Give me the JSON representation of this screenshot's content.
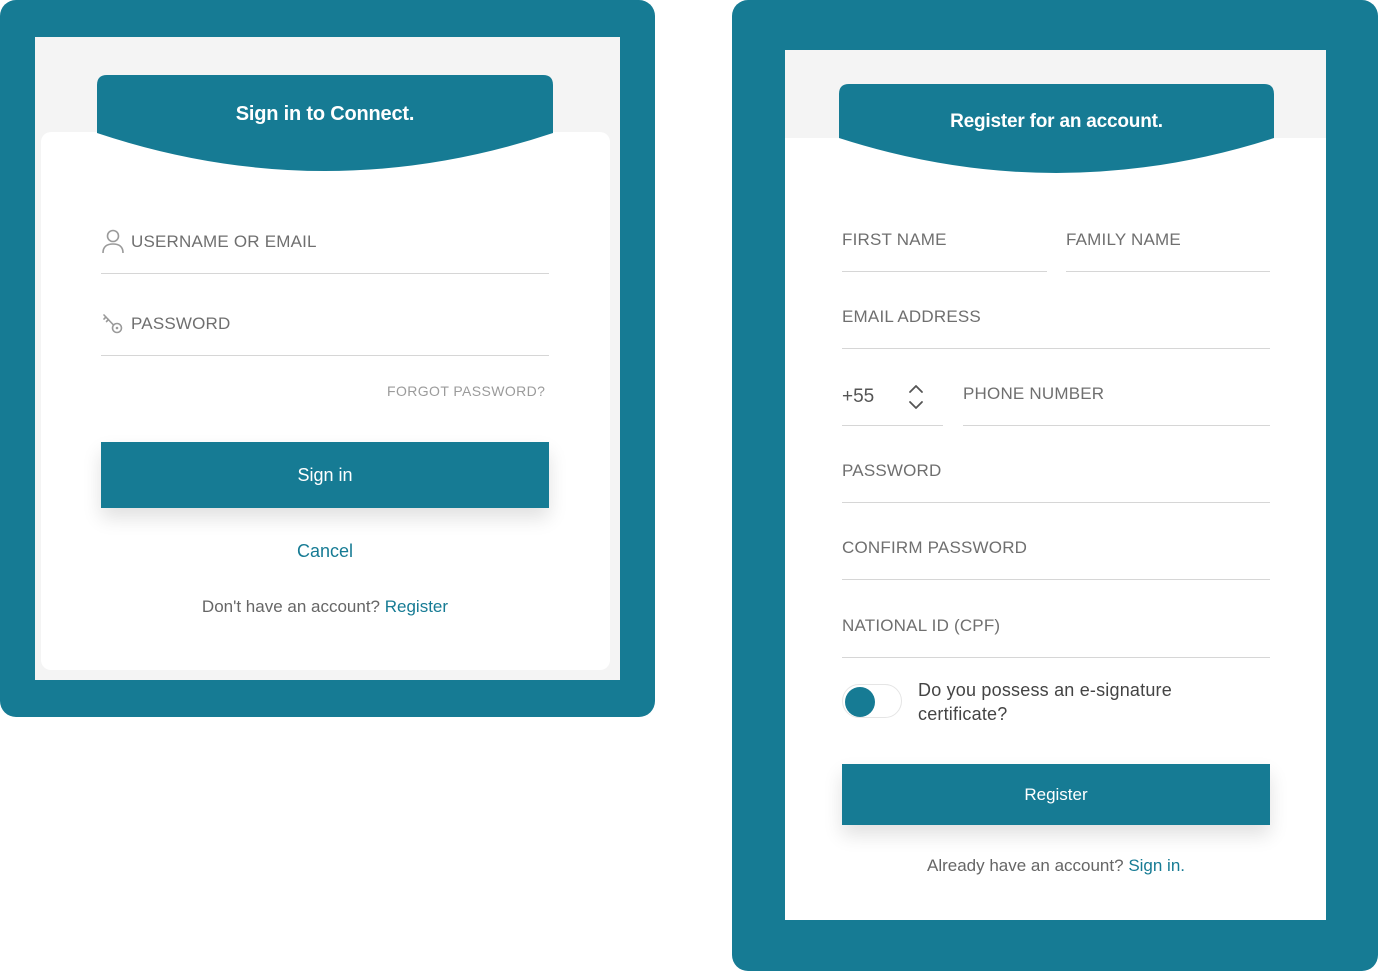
{
  "signin": {
    "title": "Sign in to Connect.",
    "username_placeholder": "USERNAME OR EMAIL",
    "password_placeholder": "PASSWORD",
    "forgot_password": "FORGOT PASSWORD?",
    "signin_button": "Sign in",
    "cancel": "Cancel",
    "no_account_text": "Don't have an account?",
    "register_link": "Register",
    "icons": {
      "username": "user-icon",
      "password": "key-icon"
    }
  },
  "register": {
    "title": "Register for an account.",
    "first_name_placeholder": "FIRST NAME",
    "family_name_placeholder": "FAMILY NAME",
    "email_placeholder": "EMAIL ADDRESS",
    "country_code": "+55",
    "phone_placeholder": "PHONE NUMBER",
    "password_placeholder": "PASSWORD",
    "confirm_password_placeholder": "CONFIRM PASSWORD",
    "national_id_placeholder": "NATIONAL ID (CPF)",
    "esignature_label": "Do you possess an e-signature certificate?",
    "esignature_toggle_on": false,
    "register_button": "Register",
    "have_account_text": "Already have an account?",
    "signin_link": "Sign in."
  },
  "colors": {
    "brand": "#167b94",
    "background": "#f4f4f4",
    "card": "#ffffff",
    "placeholder": "#6f6f6f",
    "divider": "#d6d6d6"
  }
}
